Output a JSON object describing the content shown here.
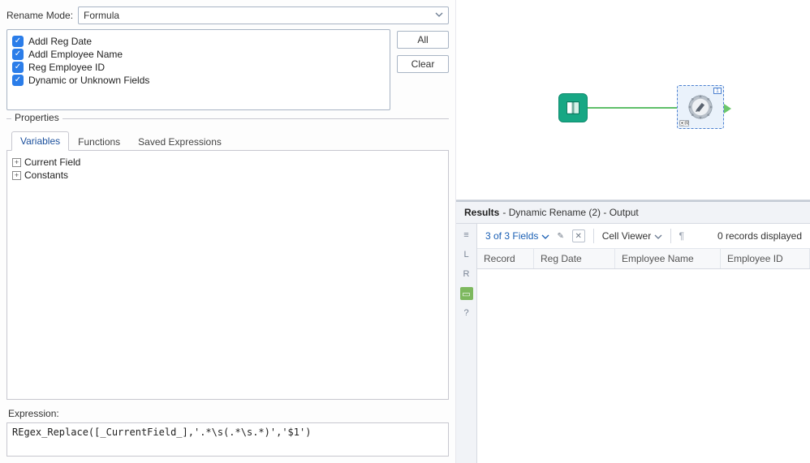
{
  "config": {
    "rename_mode_label": "Rename Mode:",
    "rename_mode_value": "Formula",
    "fields": [
      {
        "label": "Addl Reg Date",
        "checked": true
      },
      {
        "label": "Addl Employee Name",
        "checked": true
      },
      {
        "label": "Reg Employee ID",
        "checked": true
      },
      {
        "label": "Dynamic or Unknown Fields",
        "checked": true
      }
    ],
    "buttons": {
      "all": "All",
      "clear": "Clear"
    }
  },
  "properties": {
    "legend": "Properties",
    "tabs": {
      "variables": "Variables",
      "functions": "Functions",
      "saved": "Saved Expressions"
    },
    "tree": [
      {
        "label": "Current Field",
        "expandable": true
      },
      {
        "label": "Constants",
        "expandable": true
      }
    ],
    "expression_label": "Expression:",
    "expression_value": "REgex_Replace([_CurrentField_],'.*\\s(.*\\s.*)','$1')"
  },
  "canvas": {
    "input_tool": "text-input-tool",
    "output_tool": "dynamic-rename-tool",
    "badge_top": "1",
    "badge_bottom": "⦿R"
  },
  "results": {
    "title_bold": "Results",
    "title_rest": " - Dynamic Rename (2) - Output",
    "field_count": "3 of 3 Fields",
    "cell_viewer": "Cell Viewer",
    "records_display": "0 records displayed",
    "columns": {
      "record": "Record",
      "c1": "Reg Date",
      "c2": "Employee Name",
      "c3": "Employee ID"
    },
    "gutter_icons": [
      "list",
      "L",
      "R",
      "data",
      "help"
    ]
  }
}
